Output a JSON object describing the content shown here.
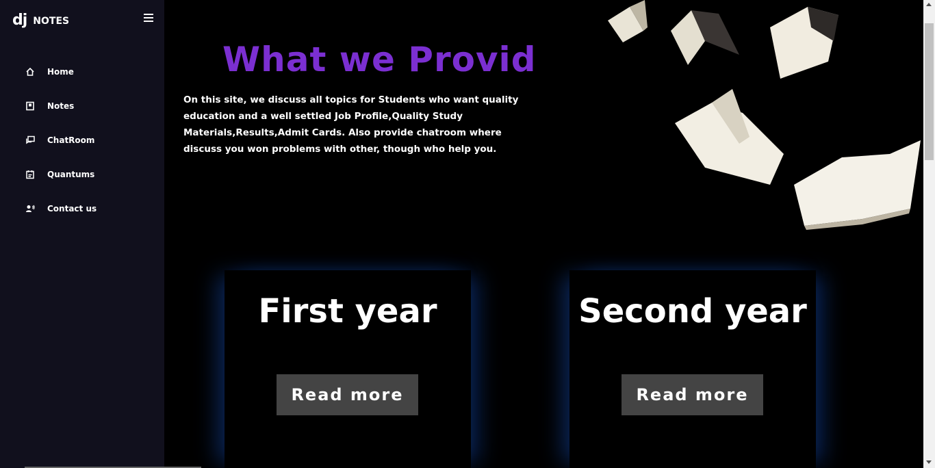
{
  "brand": {
    "logo": "dj",
    "name": "NOTES"
  },
  "sidebar": {
    "items": [
      {
        "label": "Home",
        "icon": "home-icon"
      },
      {
        "label": "Notes",
        "icon": "notes-icon"
      },
      {
        "label": "ChatRoom",
        "icon": "chatroom-icon"
      },
      {
        "label": "Quantums",
        "icon": "quantums-icon"
      },
      {
        "label": "Contact us",
        "icon": "contact-icon"
      }
    ]
  },
  "main": {
    "title": "What we Provide?",
    "description": "On this site, we discuss all topics for Students who want quality education and a well settled Job Profile,Quality Study Materials,Results,Admit Cards. Also provide chatroom where discuss you won problems with other, though who help you.",
    "cards": [
      {
        "title": "First year",
        "button": "Read more"
      },
      {
        "title": "Second year",
        "button": "Read more"
      }
    ]
  },
  "colors": {
    "sidebar_bg": "#11101d",
    "title": "#7b2fd1",
    "button_bg": "#444444",
    "card_glow": "#1446a0"
  }
}
